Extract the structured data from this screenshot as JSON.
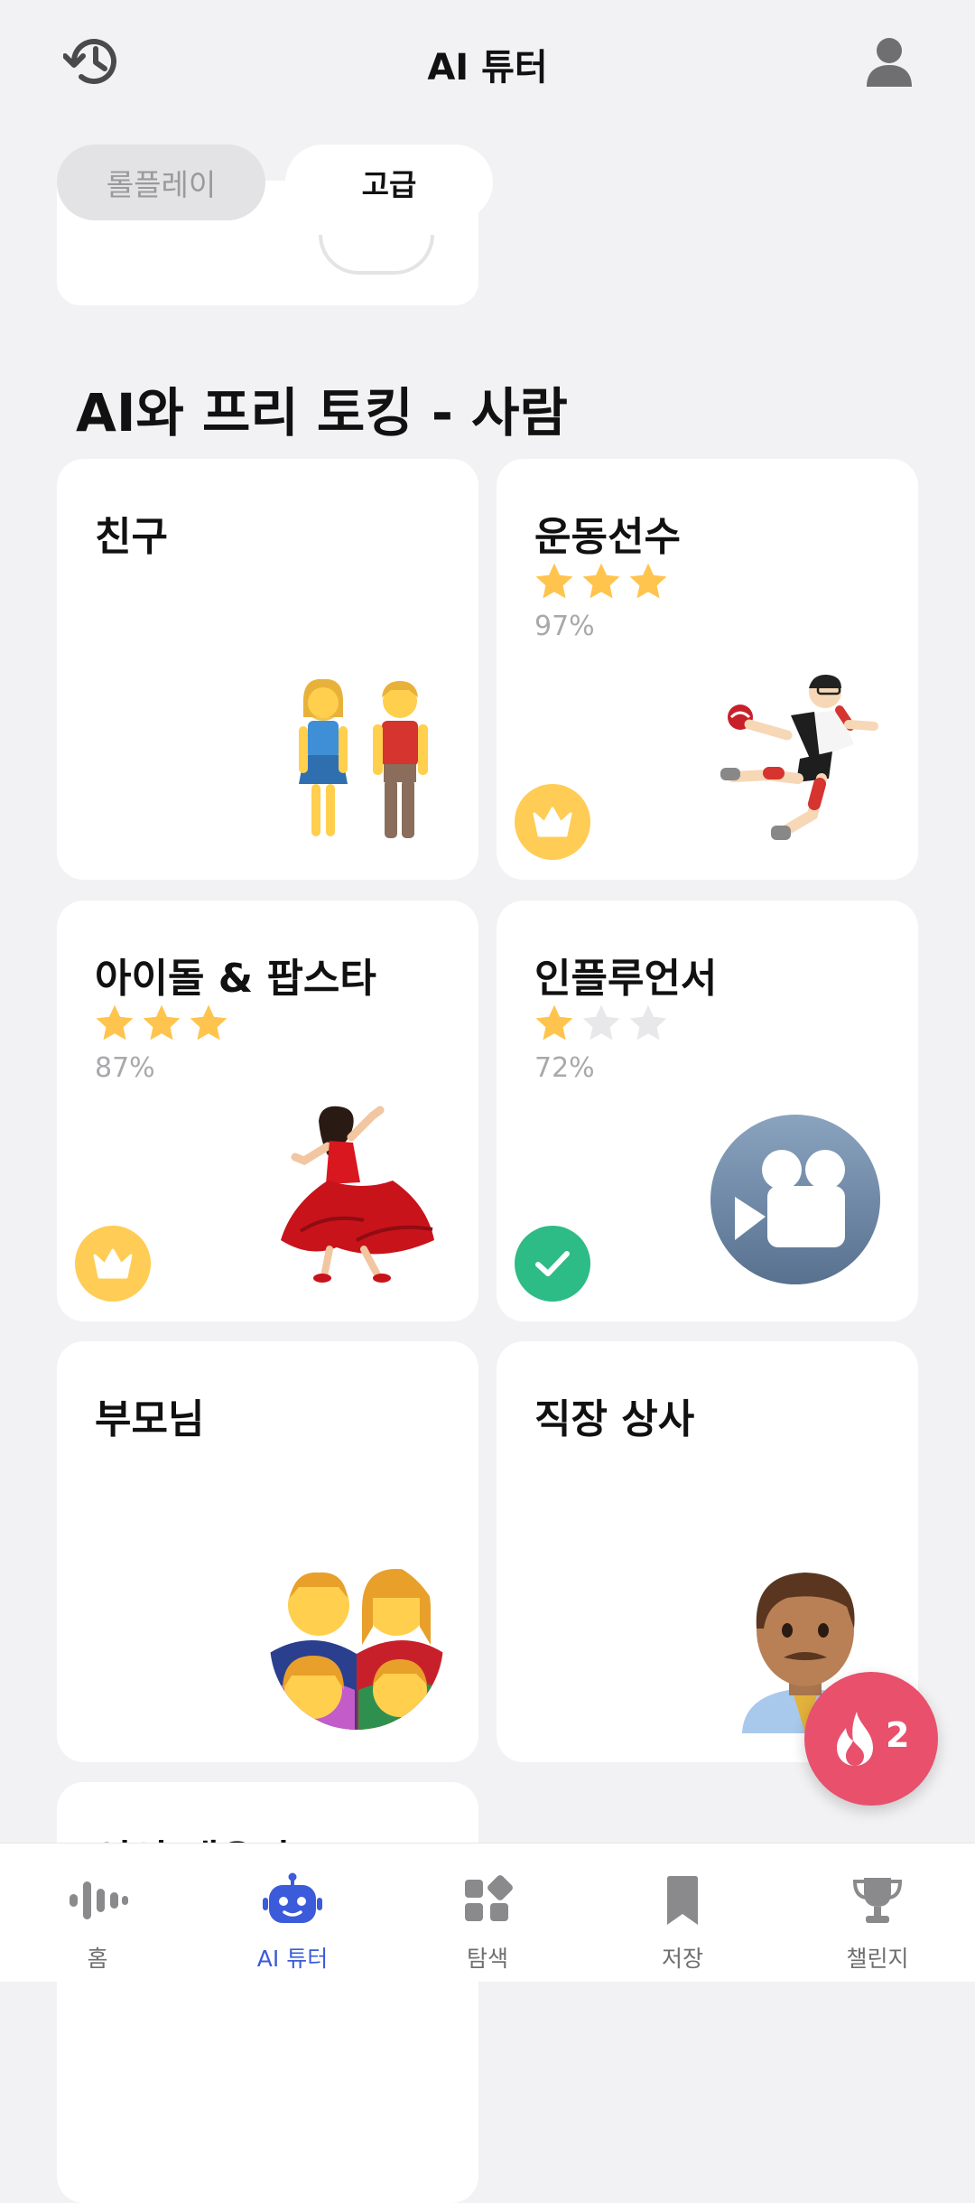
{
  "header": {
    "title": "AI 튜터",
    "history_icon": "history-icon",
    "profile_icon": "profile-icon"
  },
  "segments": {
    "roleplay": "롤플레이",
    "advanced": "고급",
    "selected": "고급"
  },
  "section": {
    "title": "AI와 프리 토킹 - 사람"
  },
  "cards": [
    {
      "title": "친구",
      "art": "couple-emoji"
    },
    {
      "title": "운동선수",
      "stars": 3,
      "pct": "97%",
      "badge": "crown-icon",
      "art": "handball-player-emoji"
    },
    {
      "title": "아이돌 & 팝스타",
      "stars": 3,
      "pct": "87%",
      "badge": "crown-icon",
      "art": "dancer-emoji"
    },
    {
      "title": "인플루언서",
      "stars": 1,
      "pct": "72%",
      "badge": "check-icon",
      "art": "video-camera-icon"
    },
    {
      "title": "부모님",
      "art": "family-emoji"
    },
    {
      "title": "직장 상사",
      "art": "man-boss-emoji"
    },
    {
      "title": "연인/배우자"
    }
  ],
  "fab": {
    "count": "2",
    "icon": "flame-icon"
  },
  "tabs": [
    {
      "label": "홈",
      "icon": "waveform-icon"
    },
    {
      "label": "AI 튜터",
      "icon": "robot-icon",
      "active": true
    },
    {
      "label": "탐색",
      "icon": "grid-explore-icon"
    },
    {
      "label": "저장",
      "icon": "bookmark-icon"
    },
    {
      "label": "챌린지",
      "icon": "trophy-icon"
    }
  ],
  "colors": {
    "background": "#f2f2f4",
    "accent": "#3b5bdb",
    "star": "#ffc44d",
    "crown_badge": "#ffcc55",
    "check_badge": "#2dbb86",
    "fab": "#e8506c"
  }
}
